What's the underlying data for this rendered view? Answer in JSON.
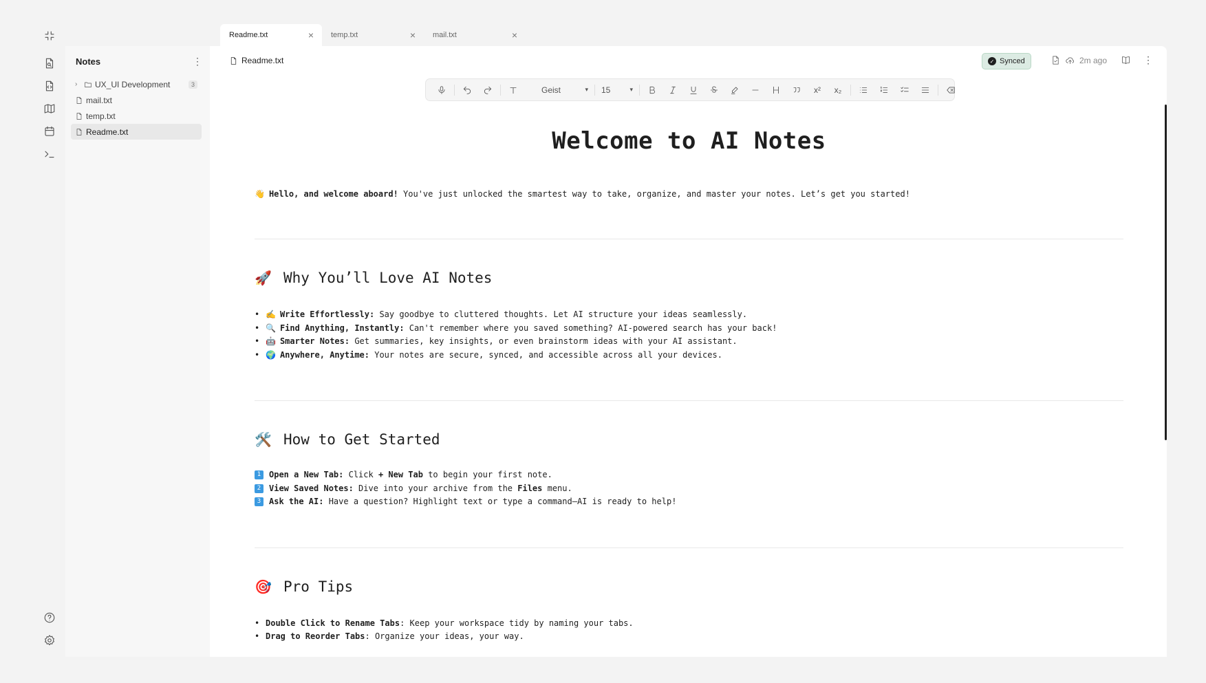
{
  "rail": {
    "icons": [
      "collapse-icon",
      "file-search-icon",
      "file-code-icon",
      "map-icon",
      "calendar-icon",
      "terminal-icon",
      "help-icon",
      "settings-icon"
    ]
  },
  "tabs": [
    {
      "label": "Readme.txt",
      "active": true
    },
    {
      "label": "temp.txt",
      "active": false
    },
    {
      "label": "mail.txt",
      "active": false
    }
  ],
  "sidebar": {
    "title": "Notes",
    "folder": {
      "label": "UX_UI Development",
      "count": "3"
    },
    "files": [
      "mail.txt",
      "temp.txt",
      "Readme.txt"
    ],
    "active_file": "Readme.txt"
  },
  "editor": {
    "file_name": "Readme.txt",
    "sync_status": "Synced",
    "last_saved": "2m ago"
  },
  "toolbar": {
    "font": "Geist",
    "font_size": "15"
  },
  "doc": {
    "title": "Welcome to AI Notes",
    "intro": {
      "emoji": "👋",
      "bold": "Hello, and welcome aboard!",
      "text": " You've just unlocked the smartest way to take, organize, and master your notes. Let’s get you started!"
    },
    "section1": {
      "emoji": "🚀",
      "heading": "Why You’ll Love AI Notes",
      "items": [
        {
          "emoji": "✍️",
          "bold": "Write Effortlessly:",
          "text": " Say goodbye to cluttered thoughts. Let AI structure your ideas seamlessly."
        },
        {
          "emoji": "🔍",
          "bold": "Find Anything, Instantly:",
          "text": " Can't remember where you saved something? AI-powered search has your back!"
        },
        {
          "emoji": "🤖",
          "bold": "Smarter Notes:",
          "text": " Get summaries, key insights, or even brainstorm ideas with your AI assistant."
        },
        {
          "emoji": "🌍",
          "bold": "Anywhere, Anytime:",
          "text": " Your notes are secure, synced, and accessible across all your devices."
        }
      ]
    },
    "section2": {
      "emoji": "🛠️",
      "heading": "How to Get Started",
      "items": [
        {
          "num": "1",
          "bold": "Open a New Tab:",
          "t1": " Click ",
          "b2": "+ New Tab",
          "t2": " to begin your first note."
        },
        {
          "num": "2",
          "bold": "View Saved Notes:",
          "t1": " Dive into your archive from the ",
          "b2": "Files",
          "t2": " menu."
        },
        {
          "num": "3",
          "bold": "Ask the AI:",
          "t1": " Have a question? Highlight text or type a command—AI is ready to help!",
          "b2": "",
          "t2": ""
        }
      ]
    },
    "section3": {
      "emoji": "🎯",
      "heading": "Pro Tips",
      "items": [
        {
          "bold": "Double Click to Rename Tabs",
          "text": ": Keep your workspace tidy by naming your tabs."
        },
        {
          "bold": "Drag to Reorder Tabs",
          "text": ": Organize your ideas, your way."
        }
      ]
    }
  }
}
